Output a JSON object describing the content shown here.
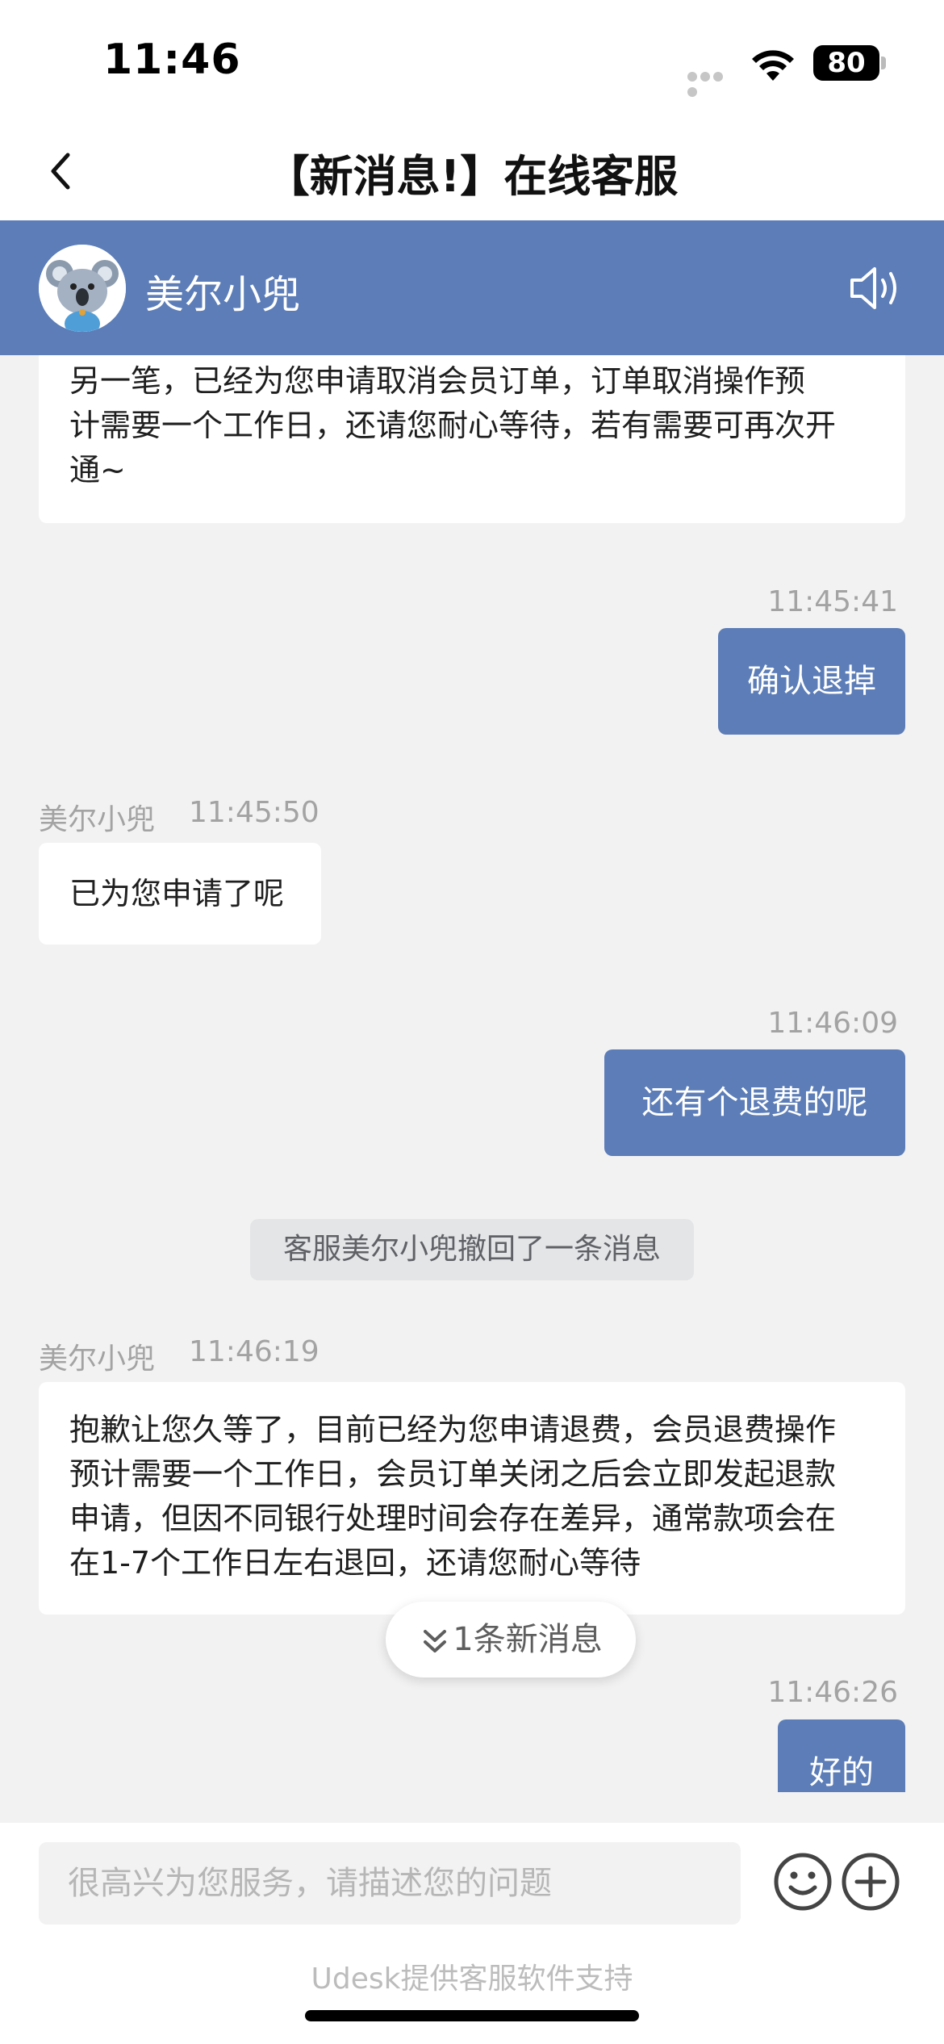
{
  "status_bar": {
    "time": "11:46",
    "battery": "80"
  },
  "nav": {
    "title": "【新消息!】在线客服"
  },
  "agent": {
    "name": "美尔小兜"
  },
  "messages": [
    {
      "kind": "agent_text",
      "lines": [
        "另一笔，已经为您申请取消会员订单，订单取消操作预",
        "计需要一个工作日，还请您耐心等待，若有需要可再次开",
        "通~"
      ]
    },
    {
      "kind": "user",
      "time": "11:45:41",
      "text": "确认退掉"
    },
    {
      "kind": "agent",
      "sender": "美尔小兜",
      "time": "11:45:50",
      "text": "已为您申请了呢"
    },
    {
      "kind": "user",
      "time": "11:46:09",
      "text": "还有个退费的呢"
    },
    {
      "kind": "system",
      "text": "客服美尔小兜撤回了一条消息"
    },
    {
      "kind": "agent",
      "sender": "美尔小兜",
      "time": "11:46:19",
      "lines": [
        "抱歉让您久等了，目前已经为您申请退费，会员退费操作",
        "预计需要一个工作日，会员订单关闭之后会立即发起退款",
        "申请，但因不同银行处理时间会存在差异，通常款项会在",
        "在1-7个工作日左右退回，还请您耐心等待"
      ]
    },
    {
      "kind": "user",
      "time": "11:46:26",
      "text": "好的"
    }
  ],
  "new_message_pill": {
    "label": "1条新消息"
  },
  "input": {
    "placeholder": "很高兴为您服务，请描述您的问题"
  },
  "footer": {
    "powered_by": "Udesk提供客服软件支持"
  },
  "colors": {
    "accent": "#5c7db7",
    "background": "#f2f2f2",
    "system_note": "#e3e5e7"
  },
  "icons": {
    "back": "chevron-left-icon",
    "speaker": "speaker-icon",
    "emoji": "emoji-icon",
    "more": "plus-circle-icon",
    "new_messages": "double-chevron-down-icon"
  }
}
